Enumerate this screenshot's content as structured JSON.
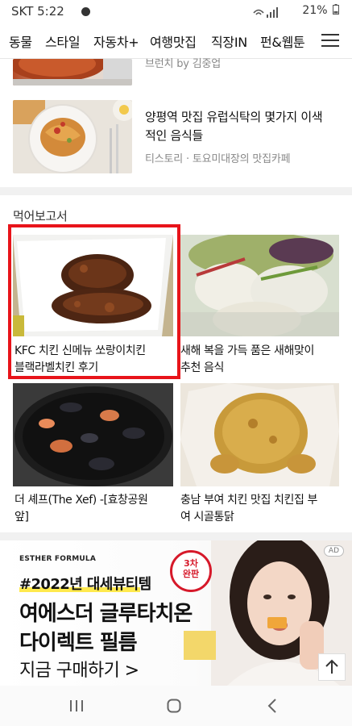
{
  "status": {
    "carrier_time": "SKT 5:22",
    "battery": "21%"
  },
  "nav": {
    "items": [
      "동물",
      "스타일",
      "자동차+",
      "여행맛집",
      "직장IN",
      "펀&웹툰"
    ]
  },
  "articles": [
    {
      "title_line1": "",
      "title_line2": "",
      "source": "브런치 by 김중업"
    },
    {
      "title_line1": "양평역 맛집 유럽식탁의 몇가지 이색",
      "title_line2": "적인 음식들",
      "source": "티스토리 · 토요미대장의 맛집카페"
    }
  ],
  "section": {
    "title": "먹어보고서",
    "cards": [
      {
        "line1": "KFC 치킨 신메뉴 쏘랑이치킨",
        "line2": "블랙라벨치킨 후기"
      },
      {
        "line1": "새해 복을 가득 품은 새해맞이",
        "line2": "추천 음식"
      },
      {
        "line1": "더 셰프(The Xef) -[효창공원",
        "line2": "앞]"
      },
      {
        "line1": "충남 부여 치킨 맛집 치킨집 부",
        "line2": "여 시골통닭"
      }
    ]
  },
  "ad": {
    "brand": "ESTHER FORMULA",
    "tag": "#2022년 대세뷰티템",
    "line1": "여에스더 글루타치온",
    "line2": "다이렉트 필름",
    "line3": "지금 구매하기 >",
    "badge_line1": "3차",
    "badge_line2": "완판",
    "ad_label": "AD",
    "accent_color": "#d6192a",
    "highlight_color": "#ffe94d"
  },
  "highlight_color": "#e8141a",
  "icons": {
    "menu": "hamburger-menu-icon",
    "scroll_top": "arrow-up-icon",
    "recent_apps": "recent-apps-icon",
    "home": "home-icon",
    "back": "back-icon"
  }
}
